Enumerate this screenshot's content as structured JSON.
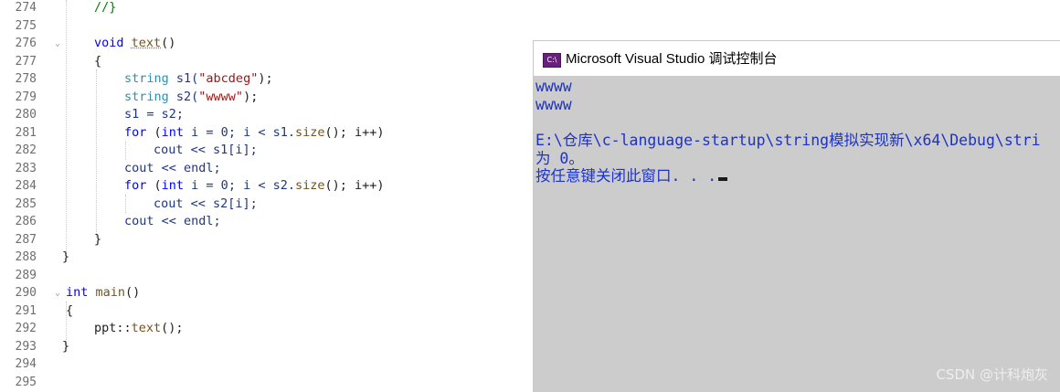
{
  "editor": {
    "line_numbers": [
      "274",
      "275",
      "276",
      "277",
      "278",
      "279",
      "280",
      "281",
      "282",
      "283",
      "284",
      "285",
      "286",
      "287",
      "288",
      "289",
      "290",
      "291",
      "292",
      "293",
      "294",
      "295"
    ],
    "code": {
      "l274": "//}",
      "l276_kw": "void",
      "l276_fn": "text",
      "l276_rest": "()",
      "l277": "{",
      "l278_ty": "string",
      "l278_a": " s1(",
      "l278_str": "\"abcdeg\"",
      "l278_b": ");",
      "l279_ty": "string",
      "l279_a": " s2(",
      "l279_str": "\"wwww\"",
      "l279_b": ");",
      "l280": "s1 = s2;",
      "l281_kw": "for",
      "l281_a": " (",
      "l281_kw2": "int",
      "l281_b": " i = 0; i < s1.",
      "l281_fn": "size",
      "l281_c": "(); i++)",
      "l282": "cout << s1[i];",
      "l283": "cout << endl;",
      "l284_kw": "for",
      "l284_a": " (",
      "l284_kw2": "int",
      "l284_b": " i = 0; i < s2.",
      "l284_fn": "size",
      "l284_c": "(); i++)",
      "l285": "cout << s2[i];",
      "l286": "cout << endl;",
      "l287": "}",
      "l288": "}",
      "l290_kw": "int",
      "l290_fn": "main",
      "l290_rest": "()",
      "l291": "{",
      "l292_a": "ppt::",
      "l292_fn": "text",
      "l292_b": "();",
      "l293": "}"
    }
  },
  "console": {
    "title": "Microsoft Visual Studio 调试控制台",
    "icon_label": "C:\\",
    "output": [
      "wwww",
      "wwww",
      "",
      "E:\\仓库\\c-language-startup\\string模拟实现新\\x64\\Debug\\stri",
      "为 0。",
      "按任意键关闭此窗口. . ."
    ],
    "background": "#cccccc",
    "text_color": "#1d33c7"
  },
  "watermark": "CSDN @计科炮灰"
}
